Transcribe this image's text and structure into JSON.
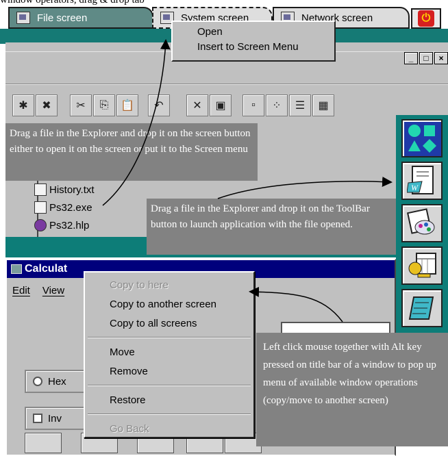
{
  "top_caption": "window operators, drag & drop tab",
  "tabs": [
    {
      "label": "File screen",
      "icon": "file-screen-icon"
    },
    {
      "label": "System screen",
      "icon": "system-screen-icon"
    },
    {
      "label": "Network screen",
      "icon": "network-screen-icon"
    }
  ],
  "tab_menu": {
    "open": "Open",
    "insert": "Insert to Screen Menu"
  },
  "window_buttons": {
    "minimize": "_",
    "maximize": "□",
    "close": "×"
  },
  "notes": {
    "explorer_drag": "Drag a file in the Explorer and drop it on the screen button either to open it on the screen or put it to the Screen menu",
    "toolbar_drag": "Drag a file in the Explorer and drop it on the ToolBar button to launch application with the file opened.",
    "alt_click": "Left click mouse  together with Alt key pressed on title bar of a window to pop up menu of available window operations (copy/move to another screen)"
  },
  "files": [
    "History.txt",
    "Ps32.exe",
    "Ps32.hlp"
  ],
  "calculator": {
    "title": "Calculat",
    "menu": [
      "Edit",
      "View"
    ],
    "hex_label": "Hex",
    "inv_label": "Inv"
  },
  "context_menu": {
    "copy_here": "Copy to here",
    "copy_another": "Copy to another screen",
    "copy_all": "Copy to all screens",
    "move": "Move",
    "remove": "Remove",
    "restore": "Restore",
    "go_back": "Go Back"
  },
  "colors": {
    "teal": "#157a75",
    "note_gray": "#828282",
    "title_blue": "#00007c"
  }
}
